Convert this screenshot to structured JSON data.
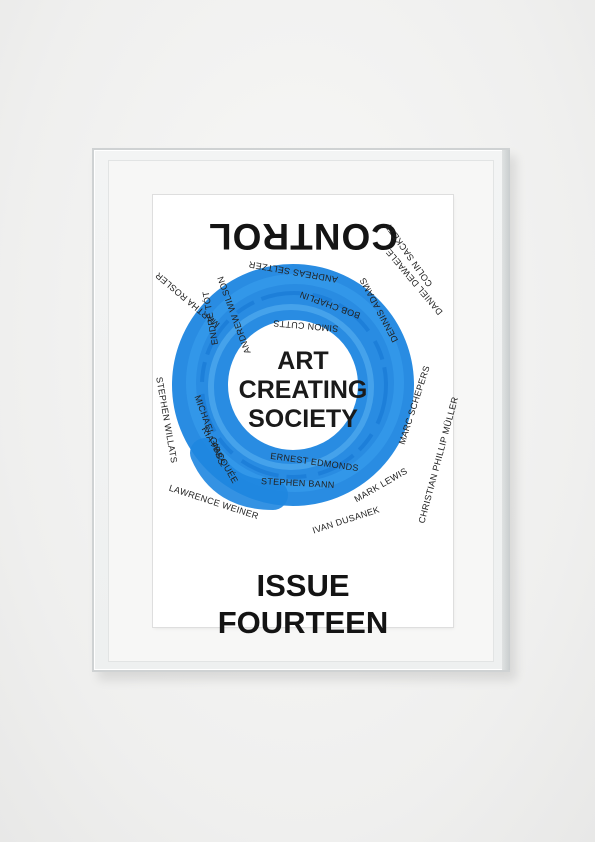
{
  "masthead": "CONTROL",
  "center_title": [
    "ART",
    "CREATING",
    "SOCIETY"
  ],
  "issue": [
    "ISSUE",
    "FOURTEEN"
  ],
  "names": [
    "COLIN SACKETT",
    "DANIEL DEWAELE",
    "DENNIS ADAMS",
    "ANDREAS SELTZER",
    "BOB CHAPLIN",
    "SIMON CUTTS",
    "ANDREW WILSON",
    "ENDRE TÓT",
    "MARTHA ROSLER",
    "STEPHEN WILLATS",
    "MICHAEL GIBBS",
    "RIA PACQUÉE",
    "MARC SCHEPERS",
    "CHRISTIAN PHILLIP MÜLLER",
    "ERNEST EDMONDS",
    "STEPHEN BANN",
    "MARK LEWIS",
    "IVAN DUSANEK",
    "LAWRENCE WEINER"
  ],
  "colors": {
    "brush": "#1f8be3",
    "brush_light": "#5cb3f2",
    "text": "#141414"
  }
}
